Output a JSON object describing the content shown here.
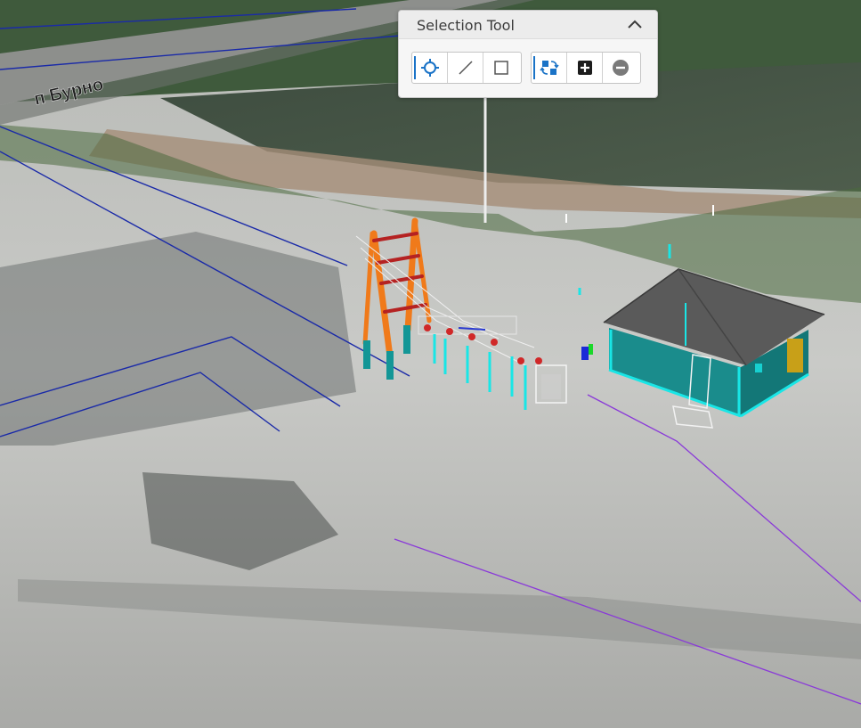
{
  "map": {
    "road_label": "п Бурно"
  },
  "selection_tool": {
    "title": "Selection Tool",
    "collapse_icon": "chevron-up-icon",
    "geometry_tools": [
      {
        "name": "point-tool",
        "icon": "crosshair-icon",
        "active": true
      },
      {
        "name": "line-tool",
        "icon": "line-icon",
        "active": false
      },
      {
        "name": "rectangle-tool",
        "icon": "rectangle-icon",
        "active": false
      }
    ],
    "mode_tools": [
      {
        "name": "new-selection",
        "icon": "replace-selection-icon",
        "active": true
      },
      {
        "name": "add-to-selection",
        "icon": "plus-square-icon",
        "active": false
      },
      {
        "name": "remove-from-selection",
        "icon": "minus-circle-icon",
        "active": false
      }
    ]
  },
  "colors": {
    "accent": "#1a73c7",
    "tower": "#f07a1a",
    "building_wall": "#1a8c8c",
    "building_roof": "#5a5a5a",
    "highlight": "#19e6e6",
    "line_blue": "#1a2aa8",
    "line_purple": "#8a3ad8"
  }
}
